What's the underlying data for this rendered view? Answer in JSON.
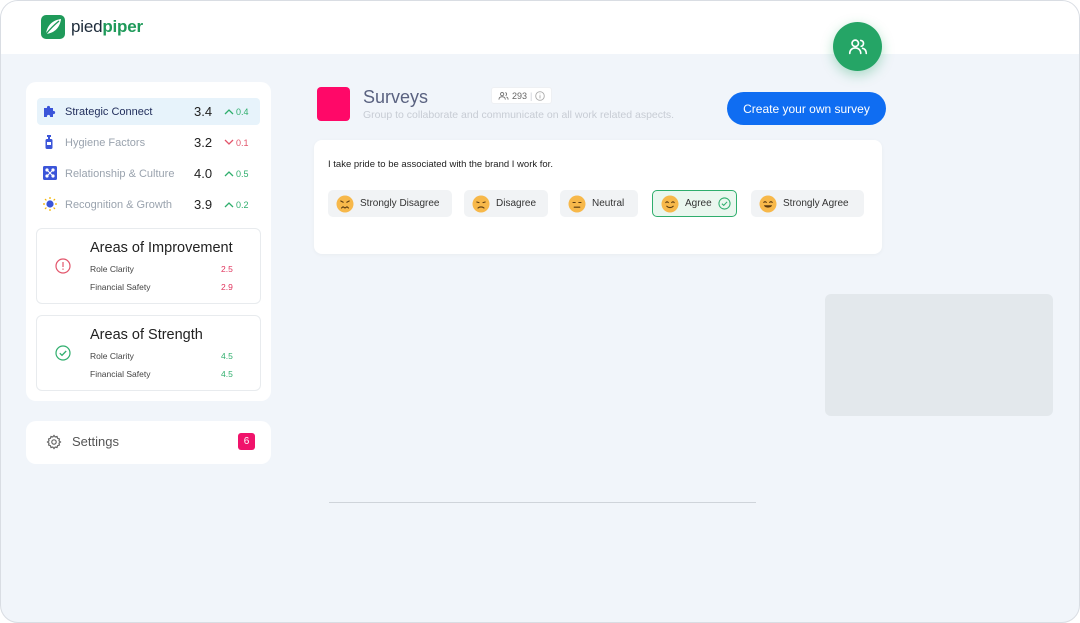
{
  "app": {
    "logo_prefix": "pied",
    "logo_suffix": "piper"
  },
  "metrics": [
    {
      "label": "Strategic Connect",
      "value": "3.4",
      "delta": "0.4",
      "direction": "up",
      "icon": "puzzle-icon"
    },
    {
      "label": "Hygiene Factors",
      "value": "3.2",
      "delta": "0.1",
      "direction": "down",
      "icon": "hand-sanitizer-icon"
    },
    {
      "label": "Relationship & Culture",
      "value": "4.0",
      "delta": "0.5",
      "direction": "up",
      "icon": "network-icon"
    },
    {
      "label": "Recognition & Growth",
      "value": "3.9",
      "delta": "0.2",
      "direction": "up",
      "icon": "lightbulb-icon"
    }
  ],
  "improvement": {
    "title": "Areas of Improvement",
    "items": [
      {
        "label": "Role Clarity",
        "score": "2.5"
      },
      {
        "label": "Financial Safety",
        "score": "2.9"
      }
    ]
  },
  "strength": {
    "title": "Areas of Strength",
    "items": [
      {
        "label": "Role Clarity",
        "score": "4.5"
      },
      {
        "label": "Financial Safety",
        "score": "4.5"
      }
    ]
  },
  "settings": {
    "label": "Settings",
    "badge": "6"
  },
  "survey": {
    "title": "Surveys",
    "participants": "293",
    "subtitle": "Group to collaborate and communicate on all work related aspects.",
    "create_label": "Create your own survey",
    "question": "I take pride to be associated with the brand I work for.",
    "options": [
      {
        "label": "Strongly Disagree",
        "icon": "angry-face-icon"
      },
      {
        "label": "Disagree",
        "icon": "sad-face-icon"
      },
      {
        "label": "Neutral",
        "icon": "neutral-face-icon"
      },
      {
        "label": "Agree",
        "icon": "smile-face-icon",
        "selected": true
      },
      {
        "label": "Strongly Agree",
        "icon": "grin-face-icon"
      }
    ]
  },
  "colors": {
    "brand_green": "#25a566",
    "accent_blue": "#0f6df2",
    "survey_pink": "#ff0868",
    "badge_pink": "#f0136b"
  }
}
